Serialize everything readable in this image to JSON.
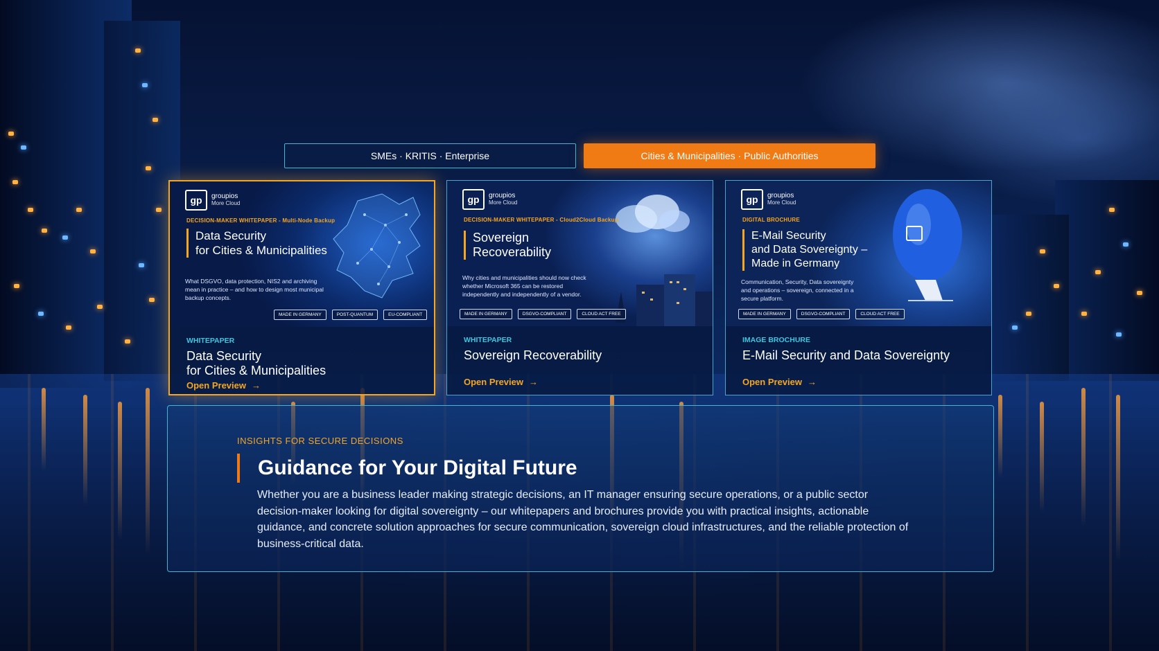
{
  "tabs": [
    {
      "label": "SMEs · KRITIS · Enterprise"
    },
    {
      "label": "Cities & Municipalities · Public Authorities"
    }
  ],
  "logo": {
    "mark": "gp",
    "name": "groupios",
    "tagline": "More Cloud"
  },
  "cards": [
    {
      "thumb_kicker": "DECISION-MAKER WHITEPAPER - Multi-Node Backup",
      "thumb_title_line1": "Data Security",
      "thumb_title_line2": "for Cities & Municipalities",
      "thumb_desc": "What DSGVO, data protection, NIS2 and archiving mean in practice – and how to design most municipal backup concepts.",
      "badges": [
        "MADE IN GERMANY",
        "POST-QUANTUM",
        "EU-COMPLIANT"
      ],
      "type": "WHITEPAPER",
      "title_line1": "Data Security",
      "title_line2": "for Cities & Municipalities",
      "cta": "Open Preview",
      "cta_icon": "arrow-right-icon"
    },
    {
      "thumb_kicker": "DECISION-MAKER WHITEPAPER - Cloud2Cloud Backup",
      "thumb_title_line1": "Sovereign",
      "thumb_title_line2": "Recoverability",
      "thumb_desc": "Why cities and municipalities should now check whether Microsoft 365 can be restored independently and independently of a vendor.",
      "badges": [
        "MADE IN GERMANY",
        "DSGVO-COMPLIANT",
        "CLOUD ACT FREE"
      ],
      "type": "WHITEPAPER",
      "title_line1": "Sovereign Recoverability",
      "cta": "Open Preview",
      "cta_icon": "arrow-right-icon"
    },
    {
      "thumb_kicker": "DIGITAL BROCHURE",
      "thumb_title_line1": "E-Mail Security",
      "thumb_title_line2": "and Data Sovereignty –",
      "thumb_title_line3": "Made in Germany",
      "thumb_desc": "Communication, Security, Data sovereignty and operations – sovereign, connected in a secure platform.",
      "badges": [
        "MADE IN GERMANY",
        "DSGVO-COMPLIANT",
        "CLOUD ACT FREE"
      ],
      "type": "IMAGE BROCHURE",
      "title_line1": "E-Mail Security and Data Sovereignty",
      "cta": "Open Preview",
      "cta_icon": "arrow-right-icon"
    }
  ],
  "insight": {
    "eyebrow": "INSIGHTS FOR SECURE DECISIONS",
    "heading": "Guidance for Your Digital Future",
    "paragraph": "Whether you are a business leader making strategic decisions, an IT manager ensuring secure operations, or a public sector decision-maker looking for digital sovereignty – our whitepapers and brochures provide you with practical insights, actionable guidance, and concrete solution approaches for secure communication, sovereign cloud infrastructures, and the reliable protection of business-critical data."
  },
  "colors": {
    "accent_orange": "#f07a14",
    "accent_gold": "#f5a623",
    "accent_cyan": "#3fb8d6",
    "background": "#0a2150"
  }
}
